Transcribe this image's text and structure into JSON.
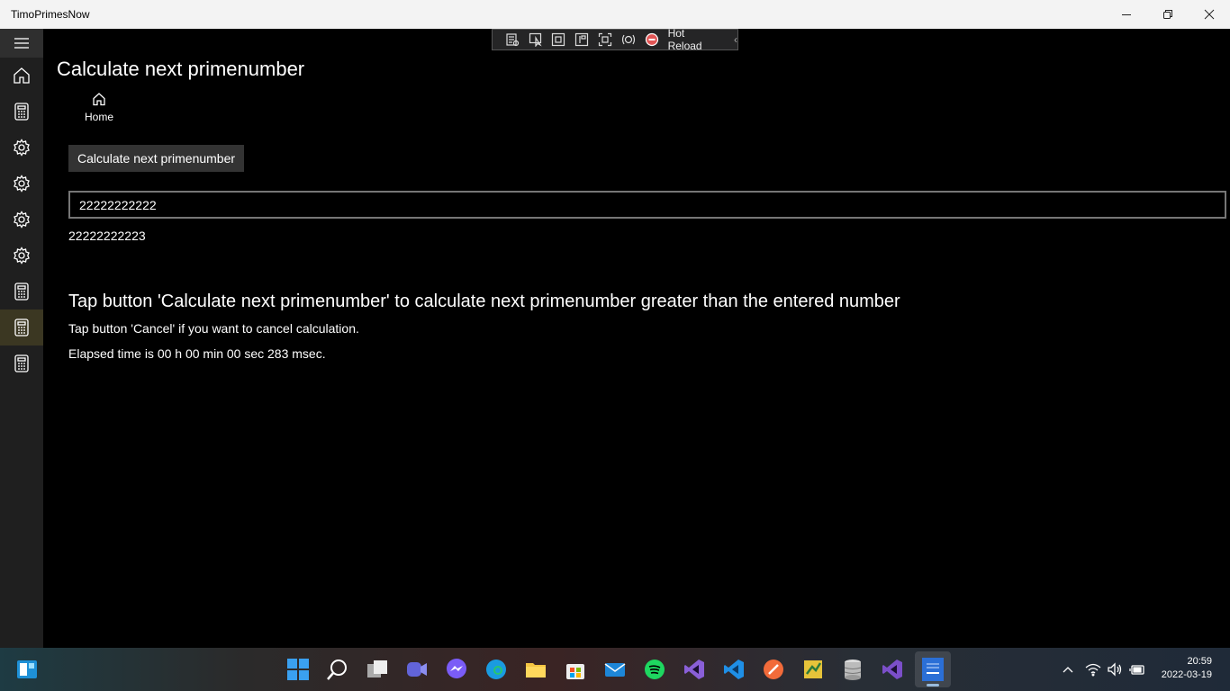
{
  "window": {
    "title": "TimoPrimesNow"
  },
  "hot_reload": {
    "label": "Hot Reload"
  },
  "page": {
    "title": "Calculate next primenumber",
    "home_label": "Home",
    "calculate_button": "Calculate next primenumber",
    "input_value": "22222222222",
    "result": "22222222223",
    "info_heading": "Tap button 'Calculate next primenumber' to calculate next primenumber greater than the entered number",
    "info_cancel": "Tap button 'Cancel' if you want to cancel calculation.",
    "elapsed": "Elapsed time is 00 h 00 min 00 sec 283 msec."
  },
  "sidebar": {
    "items": [
      "menu-icon",
      "home-icon",
      "calculator-icon",
      "gear-icon",
      "gear-icon",
      "gear-icon",
      "gear-icon",
      "calculator-icon",
      "calculator-icon",
      "calculator-icon"
    ],
    "selected_index": 8,
    "selected_color": "#3b3722"
  },
  "taskbar": {
    "icons": [
      "start-icon",
      "search-icon",
      "task-view-icon",
      "teams-icon",
      "messenger-icon",
      "edge-icon",
      "file-explorer-icon",
      "store-icon",
      "mail-icon",
      "spotify-icon",
      "visual-studio-icon",
      "vscode-icon",
      "postman-icon",
      "dependency-icon",
      "database-icon",
      "visual-studio-preview-icon",
      "timoprimesnow-icon"
    ],
    "clock_time": "20:59",
    "clock_date": "2022-03-19"
  }
}
